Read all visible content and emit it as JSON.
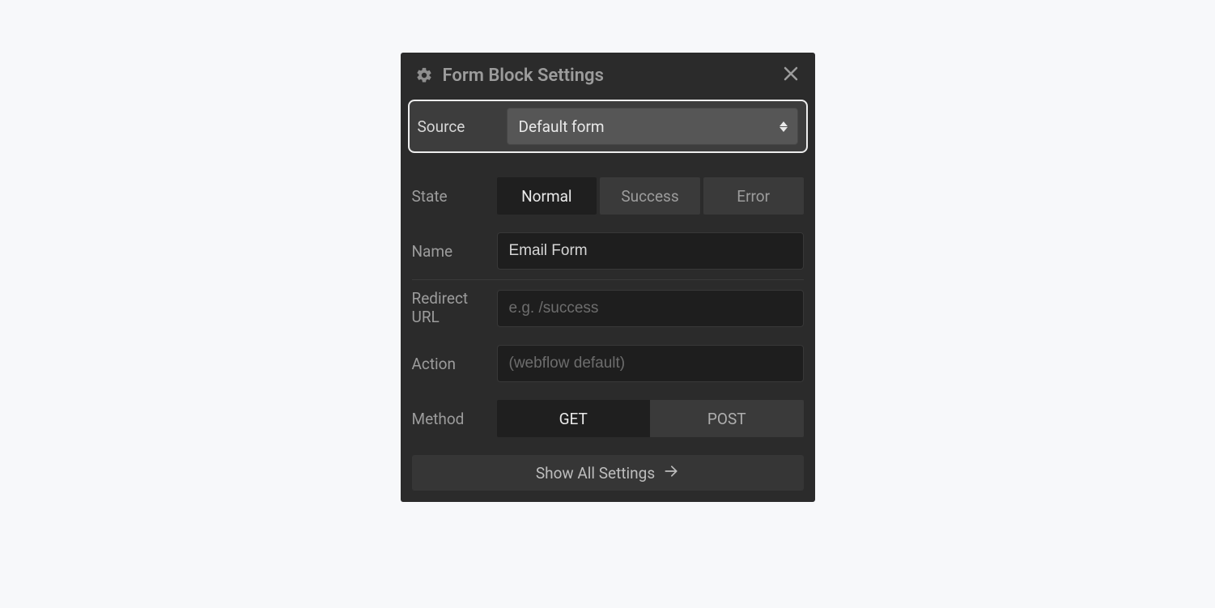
{
  "header": {
    "title": "Form Block Settings"
  },
  "source": {
    "label": "Source",
    "value": "Default form"
  },
  "state": {
    "label": "State",
    "options": [
      "Normal",
      "Success",
      "Error"
    ],
    "active": "Normal"
  },
  "name": {
    "label": "Name",
    "value": "Email Form"
  },
  "redirect": {
    "label": "Redirect URL",
    "placeholder": "e.g. /success",
    "value": ""
  },
  "action": {
    "label": "Action",
    "placeholder": "(webflow default)",
    "value": ""
  },
  "method": {
    "label": "Method",
    "options": [
      "GET",
      "POST"
    ],
    "active": "GET"
  },
  "footer": {
    "show_all": "Show All Settings"
  }
}
